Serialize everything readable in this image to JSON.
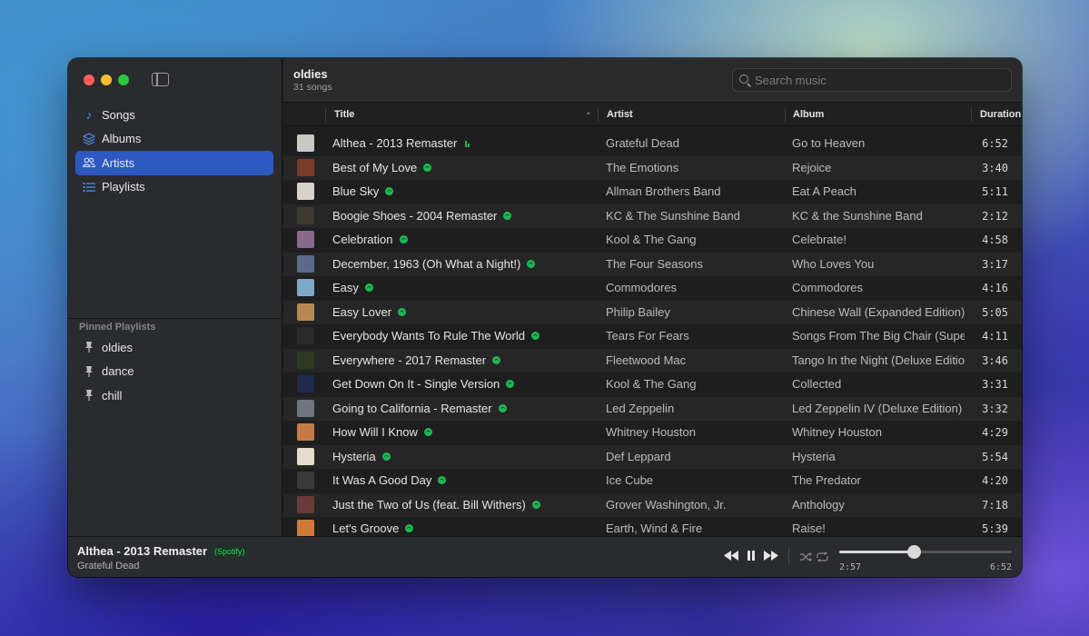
{
  "sidebar": {
    "nav": [
      {
        "label": "Songs",
        "icon": "music-note-icon"
      },
      {
        "label": "Albums",
        "icon": "albums-stack-icon"
      },
      {
        "label": "Artists",
        "icon": "people-icon",
        "active": true
      },
      {
        "label": "Playlists",
        "icon": "list-icon"
      }
    ],
    "pinned_title": "Pinned Playlists",
    "pinned": [
      {
        "label": "oldies",
        "icon": "pin-icon"
      },
      {
        "label": "dance",
        "icon": "pin-icon"
      },
      {
        "label": "chill",
        "icon": "pin-icon"
      }
    ]
  },
  "header": {
    "title": "oldies",
    "count": "31 songs",
    "search_placeholder": "Search music"
  },
  "columns": {
    "title": "Title",
    "artist": "Artist",
    "album": "Album",
    "duration": "Duration"
  },
  "songs": [
    {
      "title": "Althea - 2013 Remaster",
      "artist": "Grateful Dead",
      "album": "Go to Heaven",
      "duration": "6:52",
      "playing": true,
      "thumb": "#c9c9c4"
    },
    {
      "title": "Best of My Love",
      "artist": "The Emotions",
      "album": "Rejoice",
      "duration": "3:40",
      "thumb": "#7a3b2a"
    },
    {
      "title": "Blue Sky",
      "artist": "Allman Brothers Band",
      "album": "Eat A Peach",
      "duration": "5:11",
      "thumb": "#d8d2c8"
    },
    {
      "title": "Boogie Shoes - 2004 Remaster",
      "artist": "KC & The Sunshine Band",
      "album": "KC & the Sunshine Band",
      "duration": "2:12",
      "thumb": "#3e3a32"
    },
    {
      "title": "Celebration",
      "artist": "Kool & The Gang",
      "album": "Celebrate!",
      "duration": "4:58",
      "thumb": "#8a6a8c"
    },
    {
      "title": "December, 1963 (Oh What a Night!)",
      "artist": "The Four Seasons",
      "album": "Who Loves You",
      "duration": "3:17",
      "thumb": "#5a6a8a"
    },
    {
      "title": "Easy",
      "artist": "Commodores",
      "album": "Commodores",
      "duration": "4:16",
      "thumb": "#7fa8c8"
    },
    {
      "title": "Easy Lover",
      "artist": "Philip Bailey",
      "album": "Chinese Wall (Expanded Edition)",
      "duration": "5:05",
      "thumb": "#b78a55"
    },
    {
      "title": "Everybody Wants To Rule The World",
      "artist": "Tears For Fears",
      "album": "Songs From The Big Chair (Super Deluxe Edition)",
      "duration": "4:11",
      "thumb": "#2c2c2c"
    },
    {
      "title": "Everywhere - 2017 Remaster",
      "artist": "Fleetwood Mac",
      "album": "Tango In the Night (Deluxe Edition)",
      "duration": "3:46",
      "thumb": "#2f3a24"
    },
    {
      "title": "Get Down On It - Single Version",
      "artist": "Kool & The Gang",
      "album": "Collected",
      "duration": "3:31",
      "thumb": "#1f2a4a"
    },
    {
      "title": "Going to California - Remaster",
      "artist": "Led Zeppelin",
      "album": "Led Zeppelin IV (Deluxe Edition)",
      "duration": "3:32",
      "thumb": "#6f7480"
    },
    {
      "title": "How Will I Know",
      "artist": "Whitney Houston",
      "album": "Whitney Houston",
      "duration": "4:29",
      "thumb": "#c67a4a"
    },
    {
      "title": "Hysteria",
      "artist": "Def Leppard",
      "album": "Hysteria",
      "duration": "5:54",
      "thumb": "#e4dccd"
    },
    {
      "title": "It Was A Good Day",
      "artist": "Ice Cube",
      "album": "The Predator",
      "duration": "4:20",
      "thumb": "#3a3a3a"
    },
    {
      "title": "Just the Two of Us (feat. Bill Withers)",
      "artist": "Grover Washington, Jr.",
      "album": "Anthology",
      "duration": "7:18",
      "thumb": "#6a3a3a"
    },
    {
      "title": "Let's Groove",
      "artist": "Earth, Wind & Fire",
      "album": "Raise!",
      "duration": "5:39",
      "thumb": "#d07a3a"
    }
  ],
  "now_playing": {
    "title": "Althea - 2013 Remaster",
    "source": "(Spotify)",
    "artist": "Grateful Dead",
    "elapsed": "2:57",
    "total": "6:52",
    "progress": 0.43
  },
  "colors": {
    "accent": "#2d5ac0",
    "spotify_green": "#1db954"
  }
}
